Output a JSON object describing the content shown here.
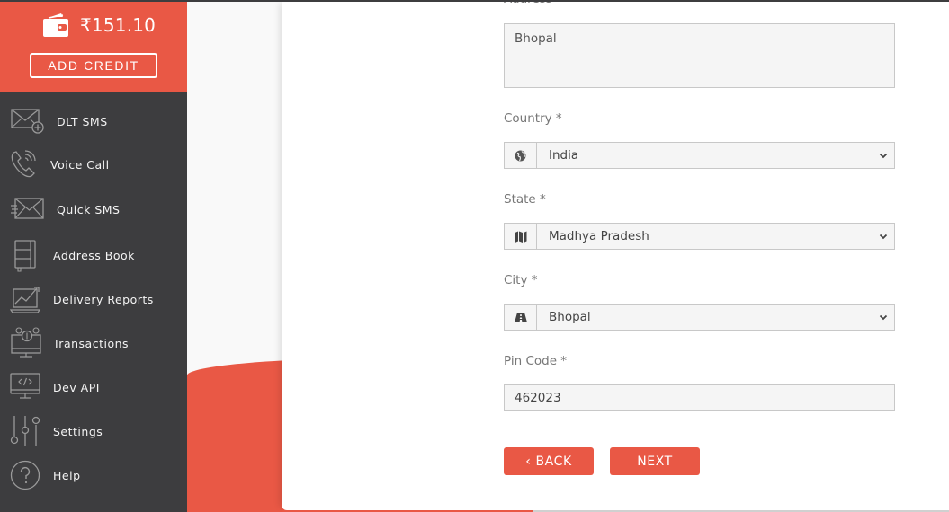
{
  "sidebar": {
    "wallet": {
      "icon": "wallet-icon",
      "balance": "₹151.10",
      "add_credit_label": "ADD CREDIT"
    },
    "items": [
      {
        "label": "DLT SMS",
        "icon": "envelope-plus-icon"
      },
      {
        "label": "Voice Call",
        "icon": "phone-ringing-icon"
      },
      {
        "label": "Quick SMS",
        "icon": "fast-envelope-icon"
      },
      {
        "label": "Address Book",
        "icon": "notebook-icon"
      },
      {
        "label": "Delivery Reports",
        "icon": "laptop-chart-icon"
      },
      {
        "label": "Transactions",
        "icon": "monitor-coins-icon"
      },
      {
        "label": "Dev API",
        "icon": "monitor-code-icon"
      },
      {
        "label": "Settings",
        "icon": "sliders-icon"
      },
      {
        "label": "Help",
        "icon": "question-circle-icon"
      }
    ]
  },
  "form": {
    "address": {
      "label": "Address",
      "value": "Bhopal"
    },
    "country": {
      "label": "Country *",
      "value": "India",
      "icon": "globe-icon"
    },
    "state": {
      "label": "State *",
      "value": "Madhya Pradesh",
      "icon": "map-icon"
    },
    "city": {
      "label": "City *",
      "value": "Bhopal",
      "icon": "road-icon"
    },
    "pin_code": {
      "label": "Pin Code *",
      "value": "462023"
    },
    "back_label": "‹ BACK",
    "next_label": "NEXT"
  },
  "colors": {
    "accent": "#e95845",
    "sidebar_bg": "#3d3d3f",
    "field_bg": "#f5f5f5"
  }
}
